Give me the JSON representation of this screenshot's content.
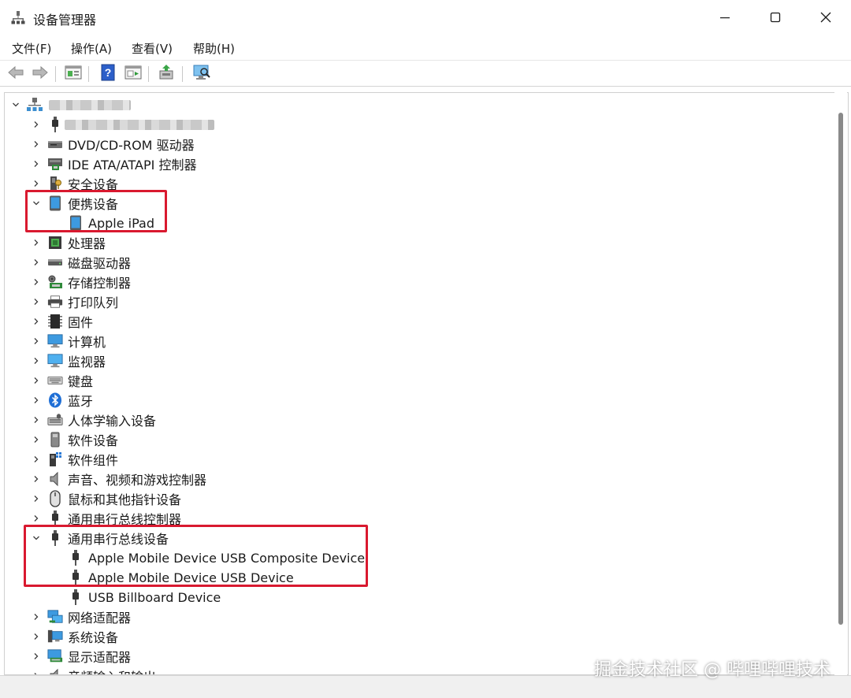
{
  "window": {
    "title": "设备管理器",
    "controls": [
      "minimize-icon",
      "maximize-icon",
      "close-icon"
    ]
  },
  "menu": {
    "items": [
      {
        "label": "文件(F)"
      },
      {
        "label": "操作(A)"
      },
      {
        "label": "查看(V)"
      },
      {
        "label": "帮助(H)"
      }
    ]
  },
  "toolbar": {
    "buttons": [
      "back-arrow-icon",
      "forward-arrow-icon",
      "properties-icon",
      "help-icon",
      "show-hide-icon",
      "update-driver-icon",
      "scan-hardware-icon"
    ]
  },
  "tree": {
    "root_label": "",
    "rows": [
      {
        "label": "",
        "expanded": false,
        "icon": "usb-connector-icon"
      },
      {
        "label": "DVD/CD-ROM 驱动器",
        "expanded": false,
        "icon": "dvd-drive-icon"
      },
      {
        "label": "IDE ATA/ATAPI 控制器",
        "expanded": false,
        "icon": "ide-controller-icon"
      },
      {
        "label": "安全设备",
        "expanded": false,
        "icon": "security-device-icon"
      },
      {
        "label": "便携设备",
        "expanded": true,
        "icon": "portable-device-icon"
      },
      {
        "label": "Apple iPad",
        "child": true,
        "icon": "ipad-icon"
      },
      {
        "label": "处理器",
        "expanded": false,
        "icon": "processor-icon"
      },
      {
        "label": "磁盘驱动器",
        "expanded": false,
        "icon": "disk-drive-icon"
      },
      {
        "label": "存储控制器",
        "expanded": false,
        "icon": "storage-controller-icon"
      },
      {
        "label": "打印队列",
        "expanded": false,
        "icon": "printer-icon"
      },
      {
        "label": "固件",
        "expanded": false,
        "icon": "firmware-icon"
      },
      {
        "label": "计算机",
        "expanded": false,
        "icon": "computer-icon"
      },
      {
        "label": "监视器",
        "expanded": false,
        "icon": "monitor-icon"
      },
      {
        "label": "键盘",
        "expanded": false,
        "icon": "keyboard-icon"
      },
      {
        "label": "蓝牙",
        "expanded": false,
        "icon": "bluetooth-icon"
      },
      {
        "label": "人体学输入设备",
        "expanded": false,
        "icon": "hid-icon"
      },
      {
        "label": "软件设备",
        "expanded": false,
        "icon": "software-device-icon"
      },
      {
        "label": "软件组件",
        "expanded": false,
        "icon": "software-component-icon"
      },
      {
        "label": "声音、视频和游戏控制器",
        "expanded": false,
        "icon": "speaker-icon"
      },
      {
        "label": "鼠标和其他指针设备",
        "expanded": false,
        "icon": "mouse-icon"
      },
      {
        "label": "通用串行总线控制器",
        "expanded": false,
        "icon": "usb-connector-icon"
      },
      {
        "label": "通用串行总线设备",
        "expanded": true,
        "icon": "usb-connector-icon"
      },
      {
        "label": "Apple Mobile Device USB Composite Device",
        "child": true,
        "icon": "usb-connector-icon"
      },
      {
        "label": "Apple Mobile Device USB Device",
        "child": true,
        "icon": "usb-connector-icon"
      },
      {
        "label": "USB Billboard Device",
        "child": true,
        "icon": "usb-connector-icon"
      },
      {
        "label": "网络适配器",
        "expanded": false,
        "icon": "network-adapter-icon"
      },
      {
        "label": "系统设备",
        "expanded": false,
        "icon": "system-device-icon"
      },
      {
        "label": "显示适配器",
        "expanded": false,
        "icon": "display-adapter-icon"
      },
      {
        "label": "音频输入和输出",
        "expanded": false,
        "icon": "audio-io-icon"
      }
    ]
  },
  "colors": {
    "highlight": "#d9192f",
    "scrollbar_thumb": "#8a8a8a",
    "status_bar": "#f0f0f0"
  },
  "watermark": "掘金技术社区 @ 哔哩哔哩技术"
}
